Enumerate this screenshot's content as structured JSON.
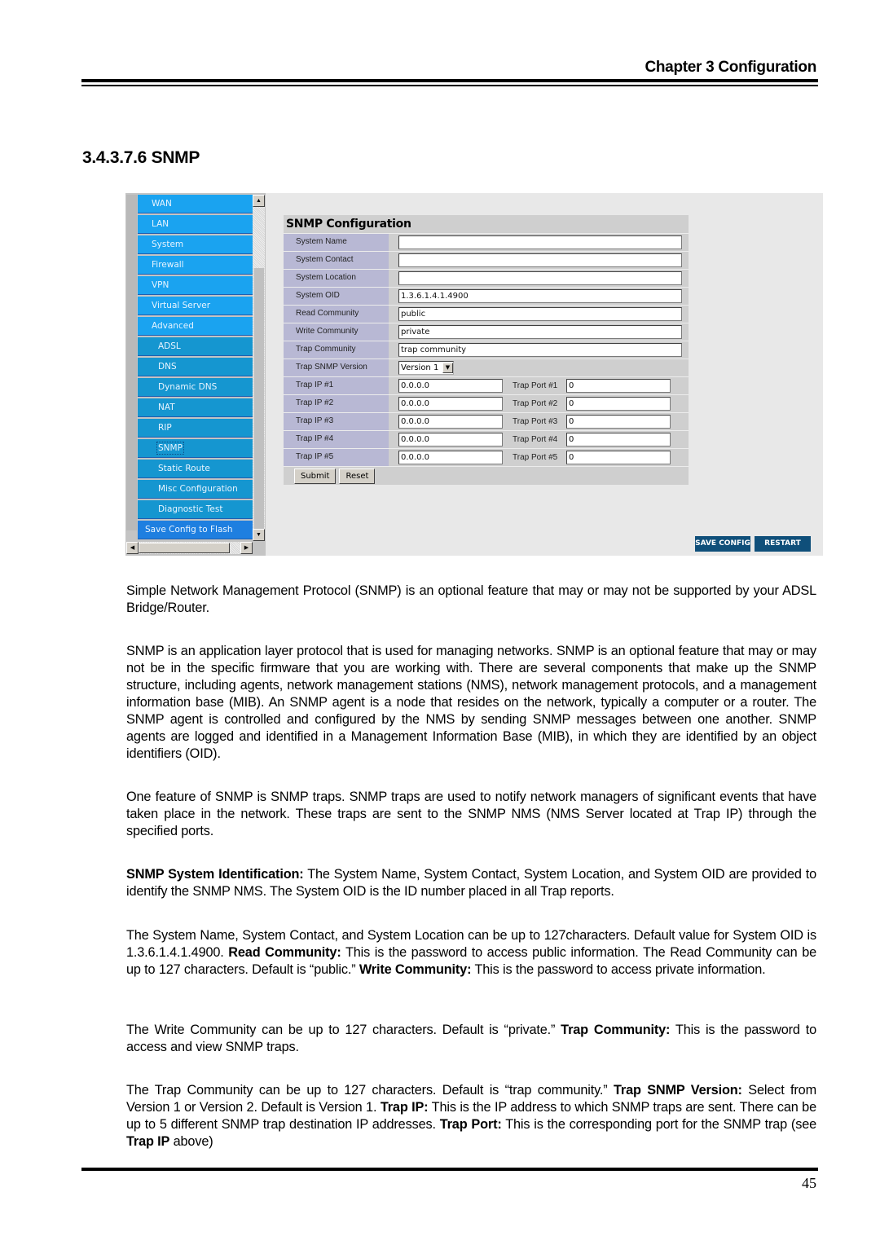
{
  "header": {
    "chapter": "Chapter 3 Configuration"
  },
  "section": {
    "title": "3.4.3.7.6 SNMP"
  },
  "screenshot": {
    "nav": {
      "items": [
        {
          "label": "WAN",
          "level": "top"
        },
        {
          "label": "LAN",
          "level": "top"
        },
        {
          "label": "System",
          "level": "top"
        },
        {
          "label": "Firewall",
          "level": "top"
        },
        {
          "label": "VPN",
          "level": "top"
        },
        {
          "label": "Virtual Server",
          "level": "top"
        },
        {
          "label": "Advanced",
          "level": "top"
        },
        {
          "label": "ADSL",
          "level": "sub"
        },
        {
          "label": "DNS",
          "level": "sub"
        },
        {
          "label": "Dynamic DNS",
          "level": "sub"
        },
        {
          "label": "NAT",
          "level": "sub"
        },
        {
          "label": "RIP",
          "level": "sub"
        },
        {
          "label": "SNMP",
          "level": "sub",
          "active": true
        },
        {
          "label": "Static Route",
          "level": "sub"
        },
        {
          "label": "Misc Configuration",
          "level": "sub"
        },
        {
          "label": "Diagnostic Test",
          "level": "sub"
        },
        {
          "label": "Save Config to Flash",
          "level": "flash"
        }
      ],
      "scroll_up_icon": "▲",
      "scroll_down_icon": "▼",
      "scroll_left_icon": "◀",
      "scroll_right_icon": "▶"
    },
    "form": {
      "title": "SNMP Configuration",
      "fields": [
        {
          "label": "System Name",
          "value": ""
        },
        {
          "label": "System Contact",
          "value": ""
        },
        {
          "label": "System Location",
          "value": ""
        },
        {
          "label": "System OID",
          "value": "1.3.6.1.4.1.4900"
        },
        {
          "label": "Read Community",
          "value": "public"
        },
        {
          "label": "Write Community",
          "value": "private"
        },
        {
          "label": "Trap Community",
          "value": "trap community"
        }
      ],
      "trap_version": {
        "label": "Trap SNMP Version",
        "selected": "Version 1",
        "arrow": "▼"
      },
      "traps": [
        {
          "ip_label": "Trap IP #1",
          "ip": "0.0.0.0",
          "port_label": "Trap Port #1",
          "port": "0"
        },
        {
          "ip_label": "Trap IP #2",
          "ip": "0.0.0.0",
          "port_label": "Trap Port #2",
          "port": "0"
        },
        {
          "ip_label": "Trap IP #3",
          "ip": "0.0.0.0",
          "port_label": "Trap Port #3",
          "port": "0"
        },
        {
          "ip_label": "Trap IP #4",
          "ip": "0.0.0.0",
          "port_label": "Trap Port #4",
          "port": "0"
        },
        {
          "ip_label": "Trap IP #5",
          "ip": "0.0.0.0",
          "port_label": "Trap Port #5",
          "port": "0"
        }
      ],
      "submit_label": "Submit",
      "reset_label": "Reset"
    },
    "save_config_label": "SAVE CONFIG",
    "restart_label": "RESTART",
    "colors": {
      "nav_top": "#1aa3f0",
      "nav_sub": "#1596d0",
      "nav_flash": "#1e7fe0",
      "label_bg": "#b8b8d4",
      "action_button": "#0f4f7a"
    }
  },
  "paragraphs": {
    "p1": "Simple Network Management Protocol (SNMP) is an optional feature that may or may not be supported by your ADSL Bridge/Router.",
    "p2": "SNMP is an application layer protocol that is used for managing networks. SNMP is an optional feature that may or may not be in the specific firmware that you are working with. There are several components that make up the SNMP structure, including agents, network management stations (NMS), network management protocols, and a management information base (MIB). An SNMP agent is a node that resides on the network, typically a computer or a router. The SNMP agent is controlled and configured by the NMS by sending SNMP messages between one another. SNMP agents are logged and identified in a Management Information Base (MIB), in which they are identified by an object identifiers (OID).",
    "p3": "One feature of SNMP is SNMP traps. SNMP traps are used to notify network managers of significant events that have taken place in the network. These traps are sent to the SNMP NMS (NMS Server located at Trap IP) through the specified ports.",
    "p4_bold": "SNMP System Identification:",
    "p4": " The System Name, System Contact, System Location, and System OID are provided to identify the SNMP NMS. The System OID is the ID number placed in all Trap reports.",
    "p5_a": "The System Name, System Contact, and System Location can be up to 127characters. Default value for System OID is 1.3.6.1.4.1.4900. ",
    "p5_b_bold": "Read Community:",
    "p5_c": " This is the password to access public information. The Read Community can be up to 127 characters. Default is “public.” ",
    "p5_d_bold": "Write Community:",
    "p5_e": " This is the password to access private information.",
    "p6_a": "The Write Community can be up to 127 characters. Default is “private.” ",
    "p6_b_bold": "Trap Community:",
    "p6_c": " This is the password to access and view SNMP traps.",
    "p7_a": "The Trap Community can be up to 127 characters. Default is “trap community.” ",
    "p7_b_bold": "Trap SNMP Version:",
    "p7_c": " Select from Version 1 or Version 2. Default is Version 1. ",
    "p7_d_bold": "Trap IP:",
    "p7_e": " This is the IP address to which SNMP traps are sent. There can be up to 5 different SNMP trap destination IP addresses. ",
    "p7_f_bold": "Trap Port:",
    "p7_g": " This is the corresponding port for the SNMP trap (see ",
    "p7_h_bold": "Trap IP",
    "p7_i": " above)"
  },
  "footer": {
    "page_number": "45"
  }
}
